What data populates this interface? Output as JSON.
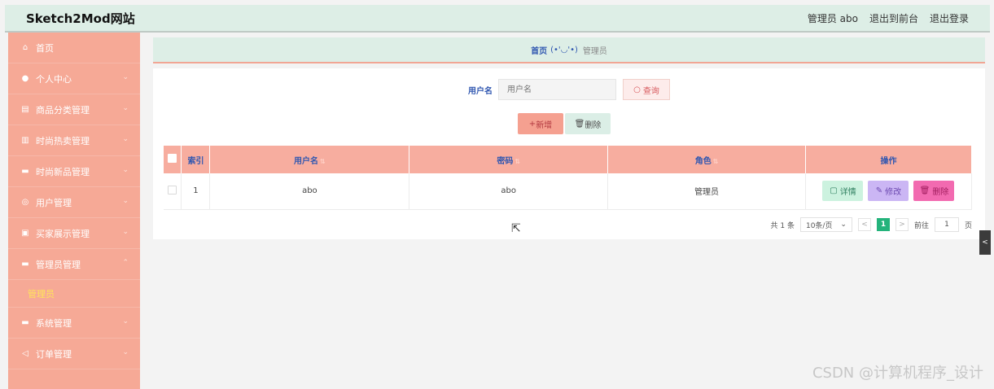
{
  "header": {
    "brand": "Sketch2Mod网站",
    "links": [
      "管理员 abo",
      "退出到前台",
      "退出登录"
    ]
  },
  "sidebar": {
    "items": [
      {
        "label": "首页",
        "icon": "home-icon",
        "expanded": false,
        "has_arrow": false
      },
      {
        "label": "个人中心",
        "icon": "user-icon",
        "expanded": false,
        "has_arrow": true
      },
      {
        "label": "商品分类管理",
        "icon": "category-icon",
        "expanded": false,
        "has_arrow": true
      },
      {
        "label": "时尚热卖管理",
        "icon": "chart-icon",
        "expanded": false,
        "has_arrow": true
      },
      {
        "label": "时尚新品管理",
        "icon": "new-product-icon",
        "expanded": false,
        "has_arrow": true
      },
      {
        "label": "用户管理",
        "icon": "users-icon",
        "expanded": false,
        "has_arrow": true
      },
      {
        "label": "买家展示管理",
        "icon": "display-icon",
        "expanded": false,
        "has_arrow": true
      },
      {
        "label": "管理员管理",
        "icon": "admin-icon",
        "expanded": true,
        "has_arrow": true
      },
      {
        "label": "系统管理",
        "icon": "settings-icon",
        "expanded": false,
        "has_arrow": true
      },
      {
        "label": "订单管理",
        "icon": "order-icon",
        "expanded": false,
        "has_arrow": true
      }
    ],
    "submenu": {
      "label": "管理员"
    }
  },
  "breadcrumb": {
    "home": "首页",
    "face": "(•'◡'•)",
    "current": "管理员"
  },
  "search": {
    "label": "用户名",
    "placeholder": "用户名",
    "button": "查询"
  },
  "actions": {
    "add": "新增",
    "delete": "删除"
  },
  "table": {
    "columns": [
      "索引",
      "用户名",
      "密码",
      "角色",
      "操作"
    ],
    "rows": [
      {
        "index": "1",
        "username": "abo",
        "password": "abo",
        "role": "管理员"
      }
    ],
    "operations": {
      "detail": "详情",
      "edit": "修改",
      "remove": "删除"
    }
  },
  "pagination": {
    "total": "共 1 条",
    "page_size": "10条/页",
    "current_page": "1",
    "goto_prefix": "前往",
    "goto_value": "1",
    "goto_suffix": "页"
  },
  "watermark": "CSDN @计算机程序_设计",
  "colors": {
    "header_bg": "#ddeee6",
    "sidebar_bg": "#f6a996",
    "table_header_bg": "#f7ad9f",
    "active_page": "#24b37b"
  }
}
